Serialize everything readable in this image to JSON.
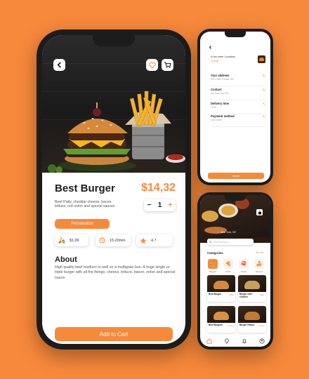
{
  "main": {
    "title": "Best Burger",
    "price": "$14,32",
    "description": "Beef Patty, cheddar cheese, bacon, lettuce, red onion and special sauces",
    "quantity": "1",
    "minus": "−",
    "plus": "+",
    "personalize_label": "Personalize",
    "delivery_fee": "$1,99",
    "delivery_time": "15-20min",
    "rating": "4.7",
    "about_title": "About",
    "about_text": "High quality beef medium to well on a multigrain bun. A huge single or triple burger with all the fixings, cheese, lettuce, bacon, onion and special sauce.",
    "cart_label": "Add to Cart",
    "accent": "#F7893B"
  },
  "checkout": {
    "order_line": "In the order 1 position",
    "change": "Change",
    "rows": [
      {
        "title": "Your address",
        "sub": "2071 Fifth St Suite 106"
      },
      {
        "title": "Contact",
        "sub": "(xx) (xxx) xxx-XXX"
      },
      {
        "title": "Delivery time",
        "sub": "12:30"
      },
      {
        "title": "Payment method",
        "sub": "Card online"
      }
    ],
    "order_button": "Order"
  },
  "home": {
    "location": "New York, NY",
    "search_placeholder": "Find Our food...",
    "categories_title": "Categories",
    "see_all": "See All",
    "categories": [
      {
        "label": "Burgers",
        "icon": "🍔"
      },
      {
        "label": "Pizza",
        "icon": "🍕"
      },
      {
        "label": "Sushi",
        "icon": "🍣"
      },
      {
        "label": "Dessert",
        "icon": "🍰"
      }
    ],
    "items": [
      {
        "name": "Best Burger",
        "price": "$8ex"
      },
      {
        "name": "Burger with chicken",
        "price": "$8ex"
      },
      {
        "name": "Beef Burgers",
        "price": "$ 10ex"
      },
      {
        "name": "Burger Palace",
        "price": "$ 20ex"
      }
    ]
  }
}
